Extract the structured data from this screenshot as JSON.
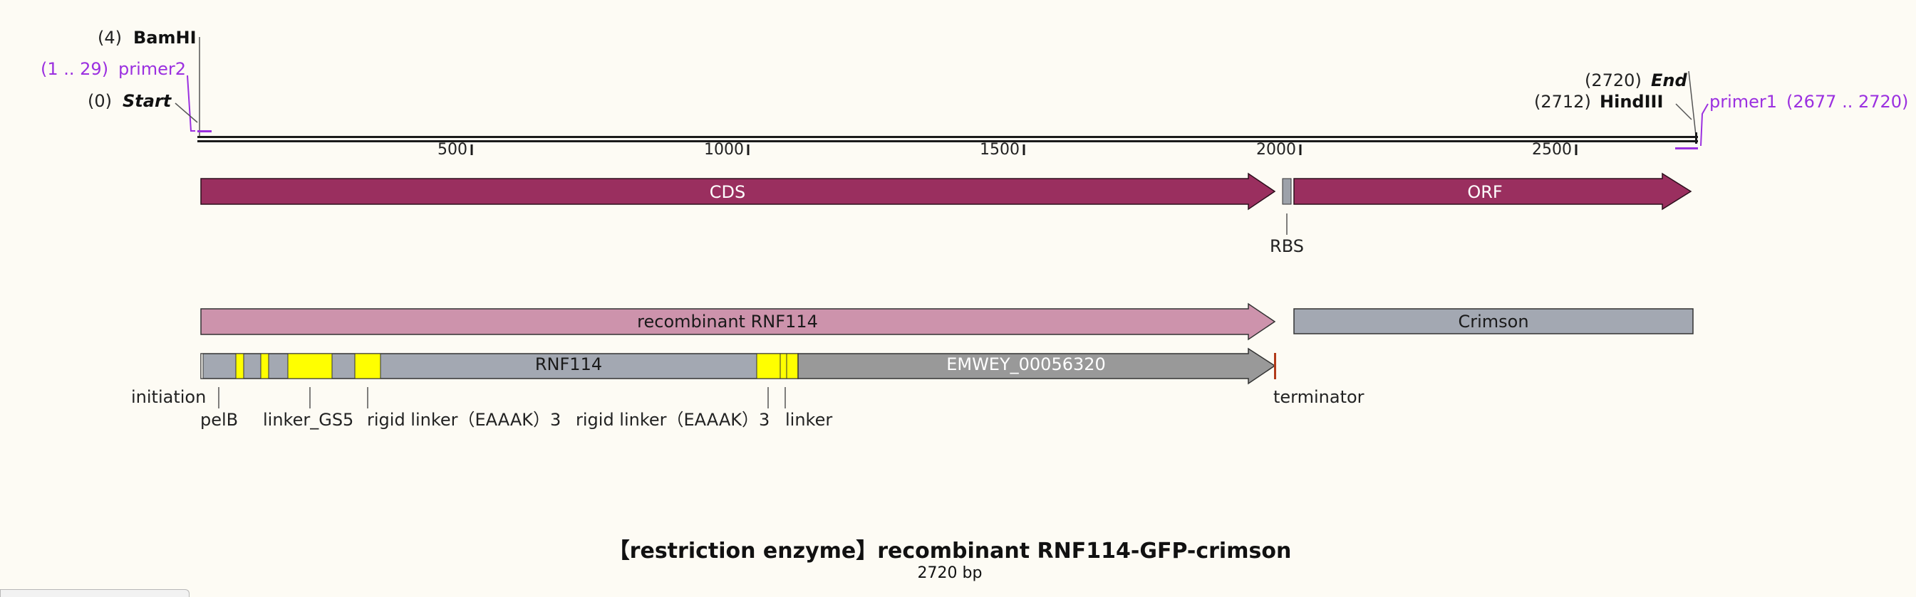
{
  "title": "【restriction enzyme】recombinant RNF114-GFP-crimson",
  "subtitle": "2720 bp",
  "sequence_length": 2720,
  "ruler_ticks": [
    "500",
    "1000",
    "1500",
    "2000",
    "2500"
  ],
  "top_labels": {
    "bamhi_pos": "(4)",
    "bamhi_name": "BamHI",
    "primer2_range": "(1 .. 29)",
    "primer2_name": "primer2",
    "start_pos": "(0)",
    "start_name": "Start",
    "end_pos": "(2720)",
    "end_name": "End",
    "hindiii_pos": "(2712)",
    "hindiii_name": "HindIII",
    "primer1_name": "primer1",
    "primer1_range": "(2677 .. 2720)"
  },
  "features": {
    "cds": "CDS",
    "orf": "ORF",
    "rbs": "RBS",
    "recombinant": "recombinant RNF114",
    "crimson": "Crimson",
    "rnf114": "RNF114",
    "emwey": "EMWEY_00056320"
  },
  "bottom_labels": {
    "initiation": "initiation",
    "pelb": "pelB",
    "linker_gs5": "linker_GS5",
    "rigid1": "rigid linker（EAAAK）3",
    "rigid2": "rigid linker（EAAAK）3",
    "linker": "linker",
    "terminator": "terminator"
  },
  "colors": {
    "background": "#fdfbf4",
    "cds_orf": "#9a2f5f",
    "recombinant": "#cd93ac",
    "gray_feature": "#a3a8b2",
    "emwey": "#999999",
    "linker_yellow": "#ffff00",
    "primer": "#9b30e0",
    "terminator": "#b23a1a"
  }
}
